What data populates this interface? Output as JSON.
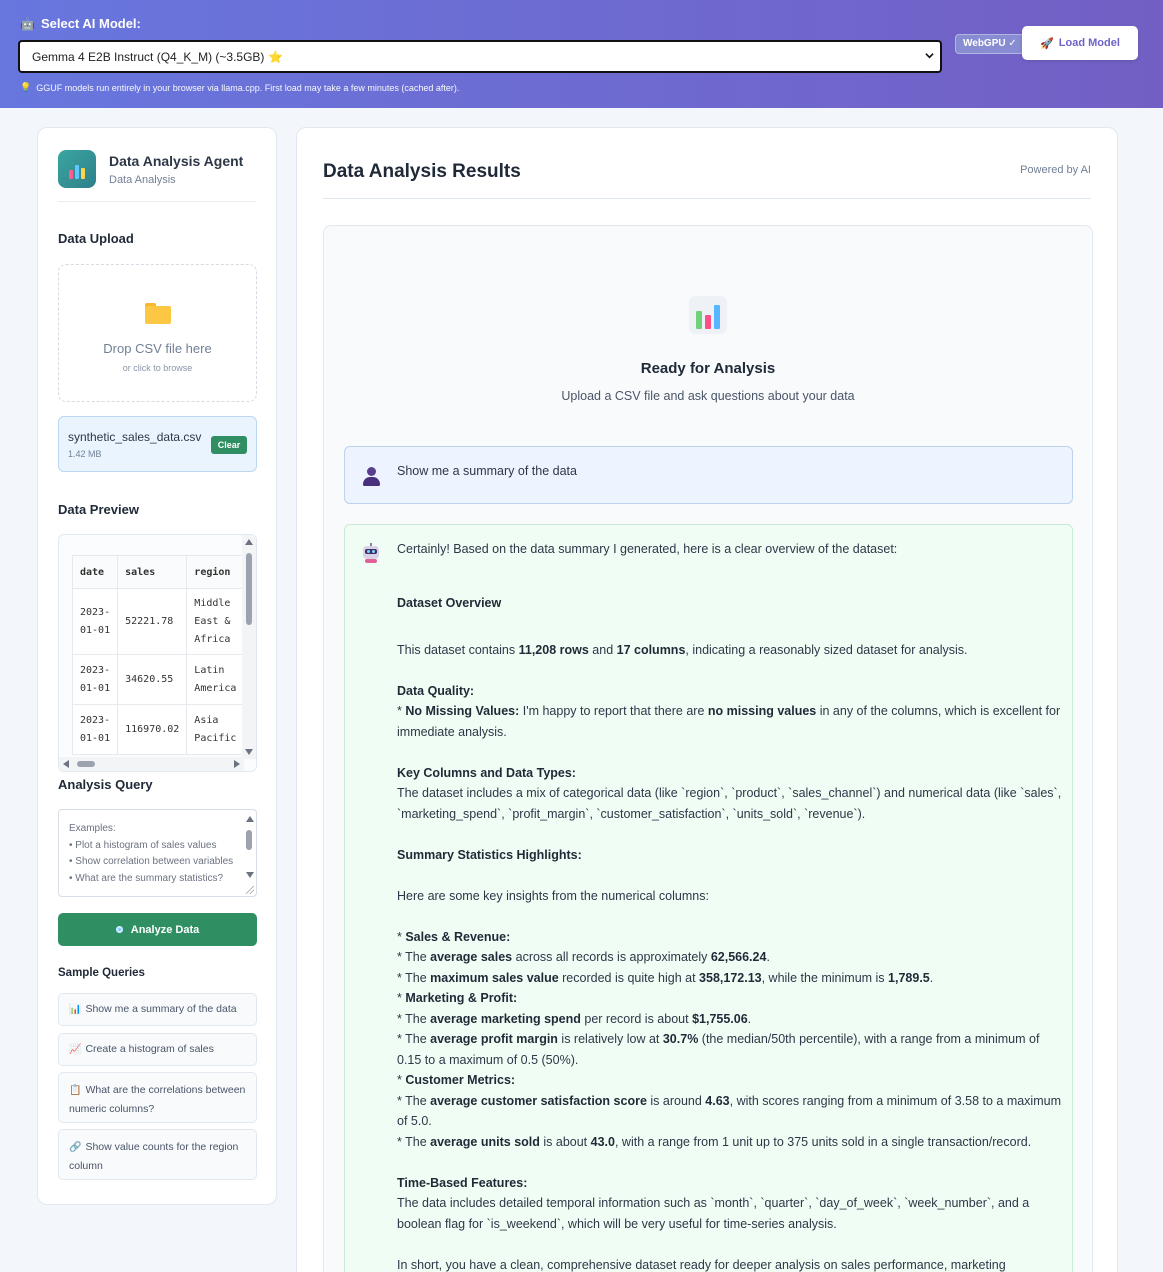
{
  "topbar": {
    "label_icon": "robot-icon",
    "label": "Select AI Model:",
    "model_selected": "Gemma 4 E2B Instruct (Q4_K_M) (~3.5GB)",
    "model_star": "⭐",
    "webgpu_badge": "WebGPU ✓",
    "load_button": "Load Model",
    "note": "GGUF models run entirely in your browser via llama.cpp. First load may take a few minutes (cached after)."
  },
  "sidebar": {
    "agent_title": "Data Analysis Agent",
    "agent_subtitle": "Data Analysis",
    "upload_title": "Data Upload",
    "drop_main": "Drop CSV file here",
    "drop_sub": "or click to browse",
    "file_name": "synthetic_sales_data.csv",
    "file_size": "1.42 MB",
    "clear_button": "Clear",
    "preview_title": "Data Preview",
    "preview_headers": [
      "date",
      "sales",
      "region"
    ],
    "preview_rows": [
      [
        "2023-\n01-01",
        "52221.78",
        "Middle\nEast &\nAfrica"
      ],
      [
        "2023-\n01-01",
        "34620.55",
        "Latin\nAmerica"
      ],
      [
        "2023-\n01-01",
        "116970.02",
        "Asia\nPacific"
      ]
    ],
    "query_title": "Analysis Query",
    "query_placeholder": "Examples:\n• Plot a histogram of sales values\n• Show correlation between variables\n• What are the summary statistics?",
    "analyze_button": "Analyze Data",
    "samples_title": "Sample Queries",
    "samples": [
      {
        "icon": "📊",
        "label": "Show me a summary of the data"
      },
      {
        "icon": "📈",
        "label": "Create a histogram of sales"
      },
      {
        "icon": "📋",
        "label": "What are the correlations between numeric columns?"
      },
      {
        "icon": "🔗",
        "label": "Show value counts for the region column"
      }
    ]
  },
  "main": {
    "title": "Data Analysis Results",
    "powered": "Powered by AI",
    "ready_title": "Ready for Analysis",
    "ready_sub": "Upload a CSV file and ask questions about your data",
    "user_message": "Show me a summary of the data",
    "ai_intro": "Certainly! Based on the data summary I generated, here is a clear overview of the dataset:",
    "ai_overview_heading": "Dataset Overview",
    "ai_overview": [
      "This dataset contains ",
      "11,208 rows",
      " and ",
      "17 columns",
      ", indicating a reasonably sized dataset for analysis."
    ],
    "ai_quality_heading": "Data Quality:",
    "ai_quality": [
      "* ",
      "No Missing Values:",
      " I'm happy to report that there are ",
      "no missing values",
      " in any of the columns, which is excellent for immediate analysis."
    ],
    "ai_types_heading": "Key Columns and Data Types:",
    "ai_types": "The dataset includes a mix of categorical data (like `region`, `product`, `sales_channel`) and numerical data (like `sales`, `marketing_spend`, `profit_margin`, `customer_satisfaction`, `units_sold`, `revenue`).",
    "ai_stats_heading": "Summary Statistics Highlights:",
    "ai_stats_intro": "Here are some key insights from the numerical columns:",
    "ai_sales_heading": "Sales & Revenue:",
    "ai_sales_1": [
      "* The ",
      "average sales",
      " across all records is approximately ",
      "62,566.24",
      "."
    ],
    "ai_sales_2": [
      "* The ",
      "maximum sales value",
      " recorded is quite high at ",
      "358,172.13",
      ", while the minimum is ",
      "1,789.5",
      "."
    ],
    "ai_mkt_heading": "Marketing & Profit:",
    "ai_mkt_1": [
      "* The ",
      "average marketing spend",
      " per record is about ",
      "$1,755.06",
      "."
    ],
    "ai_mkt_2": [
      "* The ",
      "average profit margin",
      " is relatively low at ",
      "30.7%",
      " (the median/50th percentile), with a range from a minimum of 0.15 to a maximum of 0.5 (50%)."
    ],
    "ai_cust_heading": "Customer Metrics:",
    "ai_cust_1": [
      "* The ",
      "average customer satisfaction score",
      " is around ",
      "4.63",
      ", with scores ranging from a minimum of 3.58 to a maximum of 5.0."
    ],
    "ai_cust_2": [
      "* The ",
      "average units sold",
      " is about ",
      "43.0",
      ", with a range from 1 unit up to 375 units sold in a single transaction/record."
    ],
    "ai_time_heading": "Time-Based Features:",
    "ai_time": "The data includes detailed temporal information such as `month`, `quarter`, `day_of_week`, `week_number`, and a boolean flag for `is_weekend`, which will be very useful for time-series analysis.",
    "ai_short": "In short, you have a clean, comprehensive dataset ready for deeper analysis on sales performance, marketing"
  },
  "colors": {
    "topbar_start": "#6777de",
    "topbar_end": "#735fc4",
    "accent_green": "#2f8f63",
    "user_bubble": "#eef4ff",
    "ai_bubble": "#f0fdf4"
  }
}
